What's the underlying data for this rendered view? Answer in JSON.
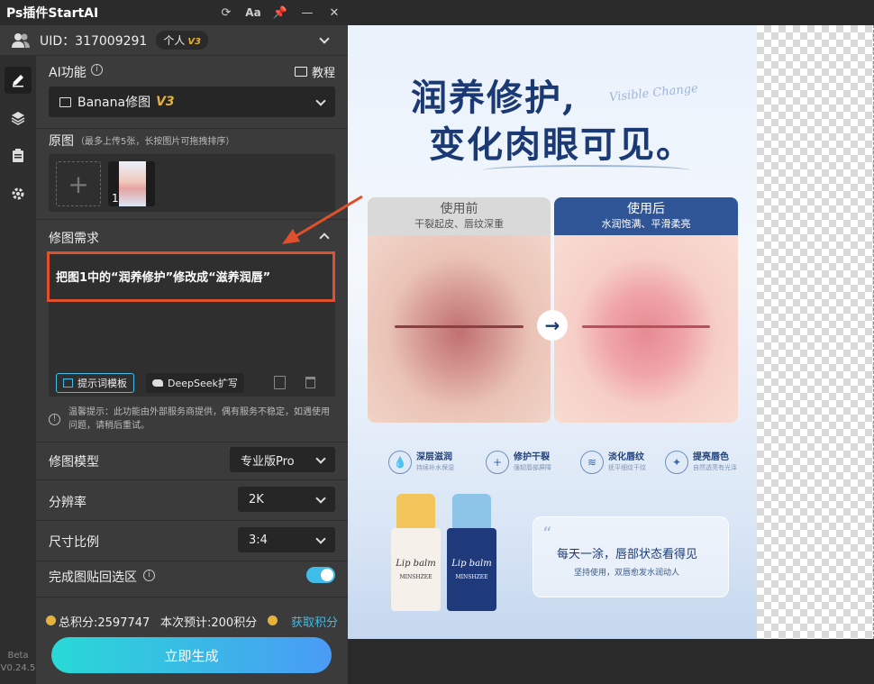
{
  "app": {
    "title": "Ps插件StartAI",
    "beta": "Beta",
    "version": "V0.24.5"
  },
  "user": {
    "uid": "UID：317009291",
    "plan": "个人",
    "plan_badge": "V3"
  },
  "ai_section": {
    "label": "AI功能",
    "tutorial": "教程",
    "model": "Banana修图",
    "model_badge": "V3"
  },
  "original": {
    "label": "原图",
    "hint": "（最多上传5张，长按图片可拖拽排序）",
    "thumb_index": "1"
  },
  "edit": {
    "label": "修图需求",
    "prompt": "把图1中的“润养修护”修改成“滋养润唇”",
    "template_btn": "提示词模板",
    "deepseek_btn": "DeepSeek扩写",
    "notice": "温馨提示：此功能由外部服务商提供，偶有服务不稳定，如遇使用问题，请稍后重试。"
  },
  "settings": {
    "model_label": "修图模型",
    "model_value": "专业版Pro",
    "resolution_label": "分辨率",
    "resolution_value": "2K",
    "ratio_label": "尺寸比例",
    "ratio_value": "3:4",
    "paste_label": "完成图贴回选区",
    "paste_on": true
  },
  "points": {
    "total": "总积分:2597747",
    "estimate": "本次预计:200积分",
    "get": "获取积分"
  },
  "generate_btn": "立即生成",
  "poster": {
    "headline1": "润养修护,",
    "headline2": "变化肉眼可见。",
    "script": "Visible Change",
    "before_title": "使用前",
    "before_sub": "干裂起皮、唇纹深重",
    "after_title": "使用后",
    "after_sub": "水润饱满、平滑柔亮",
    "features": [
      {
        "title": "深层滋润",
        "sub": "持续补水保湿"
      },
      {
        "title": "修护干裂",
        "sub": "强韧唇部屏障"
      },
      {
        "title": "淡化唇纹",
        "sub": "抚平细纹干纹"
      },
      {
        "title": "提亮唇色",
        "sub": "自然透亮有光泽"
      }
    ],
    "quote1": "每天一涂，唇部状态看得见",
    "quote2": "坚持使用，双唇愈发水润动人",
    "stick_label": "Lip balm",
    "stick_brand": "MINSHZEE"
  },
  "colors": {
    "accent": "#3fbde8",
    "highlight_border": "#e0502c",
    "gold": "#e6b23a",
    "poster_navy": "#1b3a74"
  }
}
